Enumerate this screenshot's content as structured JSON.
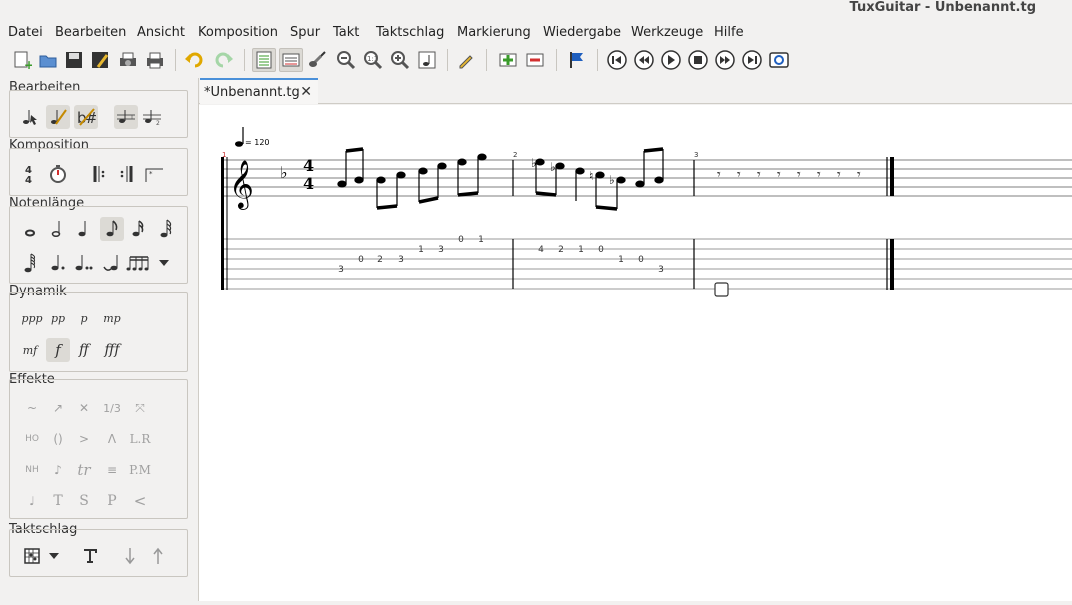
{
  "window": {
    "title": "TuxGuitar - Unbenannt.tg"
  },
  "menu": [
    "Datei",
    "Bearbeiten",
    "Ansicht",
    "Komposition",
    "Spur",
    "Takt",
    "Taktschlag",
    "Markierung",
    "Wiedergabe",
    "Werkzeuge",
    "Hilfe"
  ],
  "tab": {
    "label": "*Unbenannt.tg"
  },
  "panels": {
    "edit": "Bearbeiten",
    "composition": "Komposition",
    "duration": "Notenlänge",
    "dynamics": "Dynamik",
    "effects": "Effekte",
    "beat": "Taktschlag"
  },
  "dynamics": [
    "ppp",
    "pp",
    "p",
    "mp",
    "mf",
    "f",
    "ff",
    "fff"
  ],
  "effects": [
    "~",
    "↗",
    "✕",
    "1/3",
    "⤧",
    "HO",
    "()",
    ">",
    "Λ",
    "L.R",
    "NH",
    "♪",
    "tr",
    "≡",
    "P.M",
    "♩",
    "T",
    "S",
    "P",
    "<"
  ],
  "composition": {
    "timesig": "4/4"
  },
  "score": {
    "tempo": "= 120",
    "time_signature": [
      "4",
      "4"
    ],
    "measure_numbers": [
      "1",
      "2",
      "3"
    ],
    "tab_m1": [
      "3",
      "0",
      "2",
      "3",
      "1",
      "3",
      "0",
      "1"
    ],
    "tab_m2": [
      "4",
      "2",
      "1",
      "0",
      "1",
      "0",
      "3"
    ]
  },
  "colors": {
    "accent": "#4a90d9",
    "measure_number": "#c62828"
  }
}
